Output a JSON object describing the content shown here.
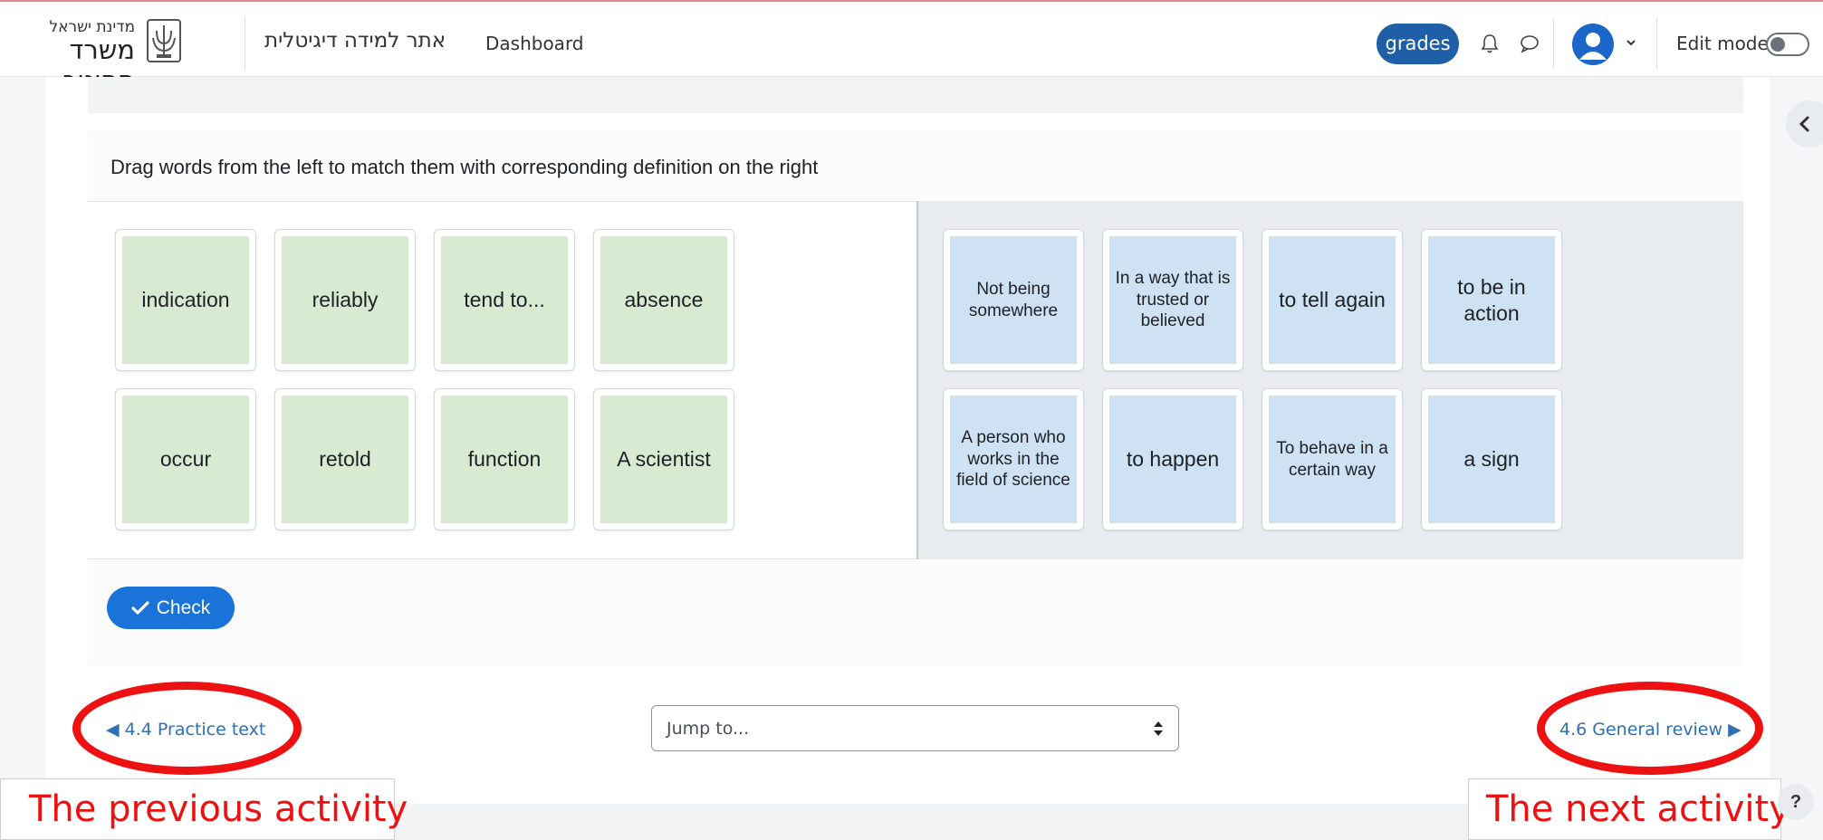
{
  "header": {
    "logo_small": "מדינת ישראל",
    "logo_big": "משרד החינוך",
    "site_name": "אתר למידה דיגיטלית",
    "dashboard": "Dashboard",
    "grades": "grades",
    "edit_mode": "Edit mode",
    "icons": [
      "emblem-icon",
      "bell-icon",
      "chat-icon",
      "user-avatar-icon",
      "chevron-down-icon"
    ]
  },
  "activity": {
    "instruction": "Drag words from the left to match them with corresponding definition on the right",
    "words": [
      "indication",
      "reliably",
      "tend to...",
      "absence",
      "occur",
      "retold",
      "function",
      "A scientist"
    ],
    "definitions": [
      "Not being somewhere",
      "In a way that is trusted or believed",
      "to tell again",
      "to be in action",
      "A person who works in the field of science",
      "to happen",
      "To behave in a certain way",
      "a sign"
    ],
    "check": "Check"
  },
  "navigation": {
    "prev": "4.4 Practice text",
    "next": "4.6 General review",
    "jump_placeholder": "Jump to..."
  },
  "annotations": {
    "prev_caption": "The previous activity",
    "next_caption": "The next activity",
    "color": "#ee1111"
  },
  "help": "?",
  "colors": {
    "grades_bg": "#1e5fa8",
    "word_card": "#d9ead3",
    "definition_card": "#cfe2f3",
    "check_btn": "#1a73d8",
    "link": "#2f6fb3"
  }
}
